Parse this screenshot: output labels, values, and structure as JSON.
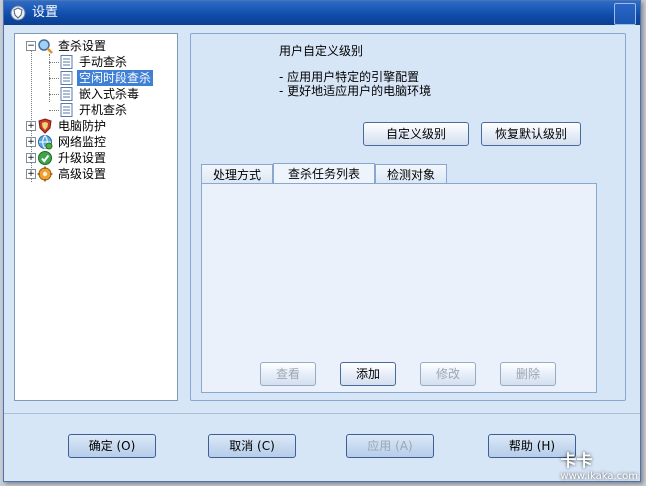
{
  "window": {
    "title": "设置"
  },
  "tree": {
    "items": [
      {
        "label": "查杀设置",
        "icon": "magnifier-icon",
        "expanded": true,
        "children": [
          {
            "label": "手动查杀",
            "icon": "document-icon"
          },
          {
            "label": "空闲时段查杀",
            "icon": "document-icon",
            "selected": true
          },
          {
            "label": "嵌入式杀毒",
            "icon": "document-icon"
          },
          {
            "label": "开机查杀",
            "icon": "document-icon"
          }
        ]
      },
      {
        "label": "电脑防护",
        "icon": "shield-icon"
      },
      {
        "label": "网络监控",
        "icon": "network-icon"
      },
      {
        "label": "升级设置",
        "icon": "update-icon"
      },
      {
        "label": "高级设置",
        "icon": "gear-icon"
      }
    ]
  },
  "panel": {
    "heading": "用户自定义级别",
    "desc": [
      "- 应用用户特定的引擎配置",
      "- 更好地适应用户的电脑环境"
    ],
    "custom_level_btn": "自定义级别",
    "restore_default_btn": "恢复默认级别",
    "tabs": [
      "处理方式",
      "查杀任务列表",
      "检测对象"
    ],
    "active_tab": 1,
    "actions": {
      "view": "查看",
      "add": "添加",
      "modify": "修改",
      "delete": "删除"
    }
  },
  "footer": {
    "ok": "确定 (O)",
    "cancel": "取消 (C)",
    "apply": "应用 (A)",
    "help": "帮助 (H)"
  },
  "watermark": {
    "text": "卡卡",
    "url": "www.ikaka.com"
  },
  "colors": {
    "title_bar": "#0f4ba8",
    "window_bg": "#d7e6f7",
    "selection": "#3f7fd6"
  }
}
